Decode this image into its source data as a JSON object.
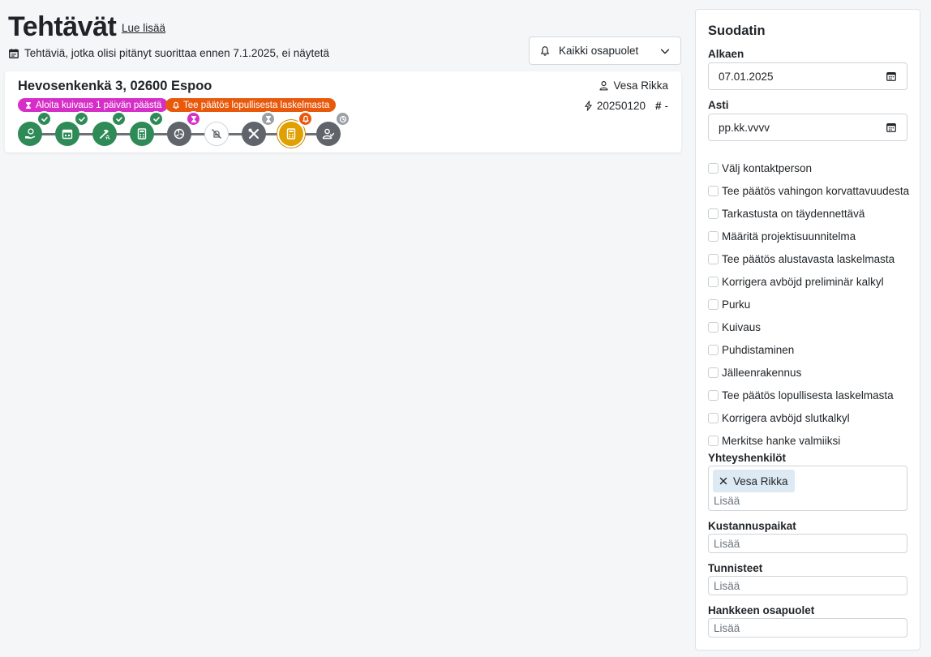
{
  "header": {
    "title": "Tehtävät",
    "read_more": "Lue lisää",
    "notice": "Tehtäviä, jotka olisi pitänyt suorittaa ennen 7.1.2025, ei näytetä",
    "notice_icon": "calendar-list-icon",
    "parties_select": {
      "value": "Kaikki osapuolet",
      "icon": "bell-icon"
    }
  },
  "task": {
    "address": "Hevosenkenkä 3, 02600 Espoo",
    "person": "Vesa Rikka",
    "id": "20250120",
    "number": "-",
    "badges": [
      {
        "label": "Aloita kuivaus 1 päivän päästä",
        "icon": "hourglass-icon",
        "color": "#d62fc8"
      },
      {
        "label": "Tee päätös lopullisesta laskelmasta",
        "icon": "bell-icon",
        "color": "#e8590c"
      }
    ],
    "steps": [
      {
        "icon": "hand-coin-icon",
        "state": "done",
        "mark": "check-icon"
      },
      {
        "icon": "calendar-icon",
        "state": "done",
        "mark": "check-icon"
      },
      {
        "icon": "hammer-break-icon",
        "state": "done",
        "mark": "check-icon"
      },
      {
        "icon": "calculator-icon",
        "state": "done",
        "mark": "check-icon"
      },
      {
        "icon": "fan-icon",
        "state": "grey",
        "mark": "hourglass-icon"
      },
      {
        "icon": "spray-off-icon",
        "state": "skip",
        "mark": ""
      },
      {
        "icon": "tools-icon",
        "state": "grey",
        "mark": "hourglass-icon"
      },
      {
        "icon": "calculator-icon",
        "state": "active",
        "mark": "bell-icon"
      },
      {
        "icon": "user-check-icon",
        "state": "grey",
        "mark": "clock-icon"
      }
    ]
  },
  "filter": {
    "title": "Suodatin",
    "from_label": "Alkaen",
    "from_value": "07.01.2025",
    "to_label": "Asti",
    "to_placeholder": "pp.kk.vvvv",
    "checkboxes": [
      "Välj kontaktperson",
      "Tee päätös vahingon korvattavuudesta",
      "Tarkastusta on täydennettävä",
      "Määritä projektisuunnitelma",
      "Tee päätös alustavasta laskelmasta",
      "Korrigera avböjd preliminär kalkyl",
      "Purku",
      "Kuivaus",
      "Puhdistaminen",
      "Jälleenrakennus",
      "Tee päätös lopullisesta laskelmasta",
      "Korrigera avböjd slutkalkyl",
      "Merkitse hanke valmiiksi"
    ],
    "contacts_label": "Yhteyshenkilöt",
    "contacts_chip": "Vesa Rikka",
    "add_placeholder": "Lisää",
    "cost_centers_label": "Kustannuspaikat",
    "tags_label": "Tunnisteet",
    "parties_label": "Hankkeen osapuolet"
  },
  "colors": {
    "done": "#2e8b57",
    "grey": "#5f656b",
    "active": "#e0a100",
    "magenta": "#d62fc8",
    "orange": "#e8590c"
  }
}
